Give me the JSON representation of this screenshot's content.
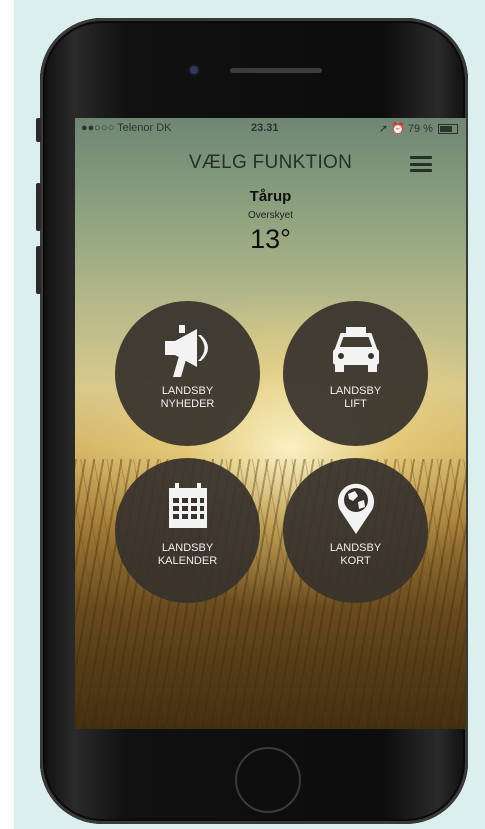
{
  "status_bar": {
    "carrier": "●●○○○ Telenor DK",
    "time": "23.31",
    "battery": "79 %"
  },
  "header": {
    "title": "VÆLG FUNKTION",
    "menu_icon": "hamburger-menu-icon"
  },
  "weather": {
    "location": "Tårup",
    "condition": "Overskyet",
    "temperature": "13°"
  },
  "tiles": [
    {
      "line1": "LANDSBY",
      "line2": "NYHEDER",
      "icon": "megaphone-icon"
    },
    {
      "line1": "LANDSBY",
      "line2": "LIFT",
      "icon": "car-icon"
    },
    {
      "line1": "LANDSBY",
      "line2": "KALENDER",
      "icon": "calendar-icon"
    },
    {
      "line1": "LANDSBY",
      "line2": "KORT",
      "icon": "map-pin-globe-icon"
    }
  ],
  "colors": {
    "tile_bg": "#37322c",
    "title_text": "#24312b",
    "backdrop": "#dcefef"
  }
}
